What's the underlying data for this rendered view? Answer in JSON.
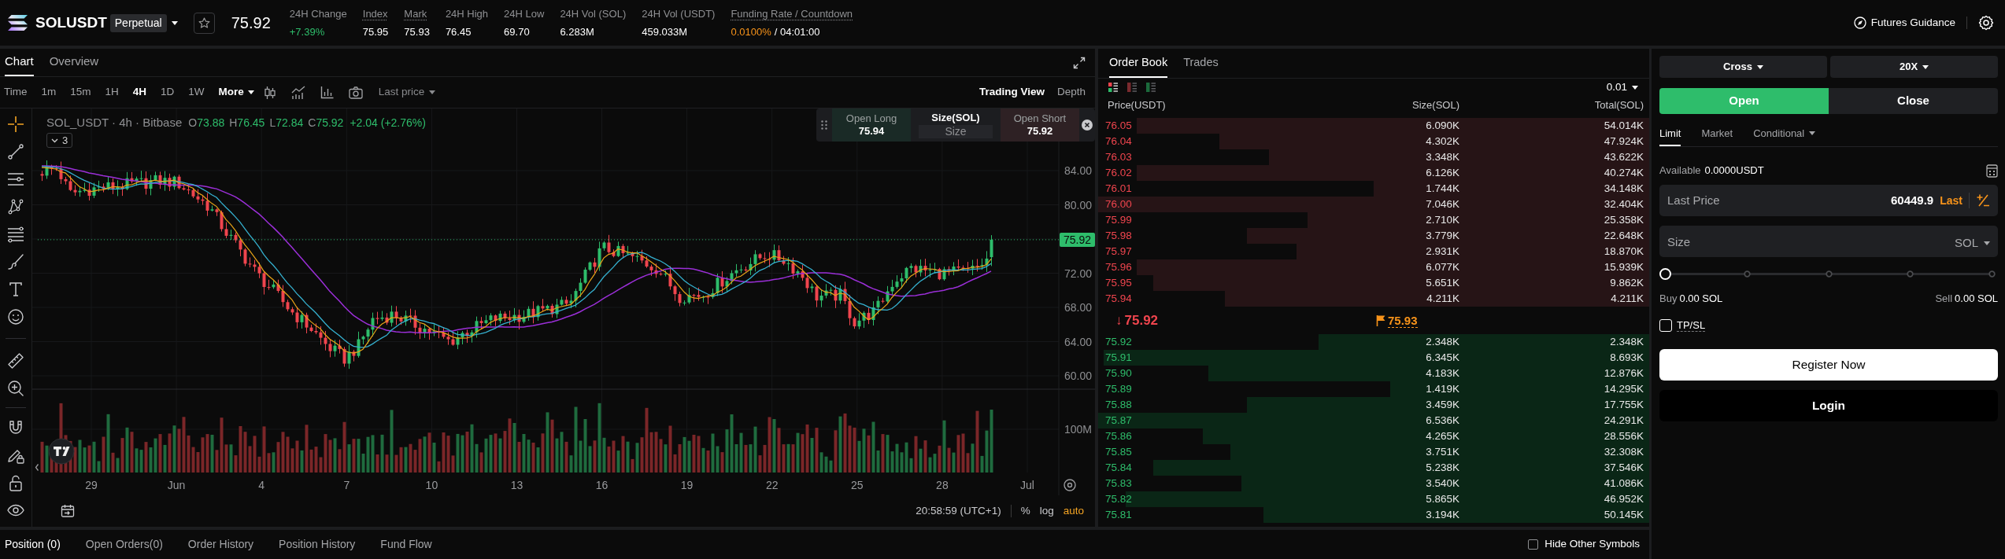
{
  "header": {
    "symbol": "SOLUSDT",
    "contract_type": "Perpetual",
    "last_price": "75.92",
    "stats": [
      {
        "label": "24H Change",
        "value": "+7.39%",
        "kind": "up",
        "tooltip": false
      },
      {
        "label": "Index",
        "value": "75.95",
        "kind": "plain",
        "tooltip": true
      },
      {
        "label": "Mark",
        "value": "75.93",
        "kind": "plain",
        "tooltip": true
      },
      {
        "label": "24H High",
        "value": "76.45",
        "kind": "plain",
        "tooltip": false
      },
      {
        "label": "24H Low",
        "value": "69.70",
        "kind": "plain",
        "tooltip": false
      },
      {
        "label": "24H Vol (SOL)",
        "value": "6.283M",
        "kind": "plain",
        "tooltip": false
      },
      {
        "label": "24H Vol (USDT)",
        "value": "459.033M",
        "kind": "plain",
        "tooltip": false
      },
      {
        "label": "Funding Rate / Countdown",
        "value": "0.0100%",
        "countdown": "/ 04:01:00",
        "kind": "funding",
        "tooltip": true
      }
    ],
    "guidance": "Futures Guidance"
  },
  "chart": {
    "tabs": [
      {
        "label": "Chart",
        "selected": true
      },
      {
        "label": "Overview",
        "selected": false
      }
    ],
    "intervals": [
      {
        "label": "Time",
        "selected": false
      },
      {
        "label": "1m",
        "selected": false
      },
      {
        "label": "15m",
        "selected": false
      },
      {
        "label": "1H",
        "selected": false
      },
      {
        "label": "4H",
        "selected": true
      },
      {
        "label": "1D",
        "selected": false
      },
      {
        "label": "1W",
        "selected": false
      }
    ],
    "more": "More",
    "price_source": "Last price",
    "views": [
      {
        "label": "Trading View",
        "selected": true
      },
      {
        "label": "Depth",
        "selected": false
      }
    ],
    "drawing_tools": [
      {
        "kind": "crosshair",
        "selected": true
      },
      {
        "kind": "trend-line",
        "selected": false
      },
      {
        "kind": "horizontal-lines",
        "selected": false
      },
      {
        "kind": "pattern",
        "selected": false
      },
      {
        "kind": "parallel-lines",
        "selected": false
      },
      {
        "kind": "brush",
        "selected": false
      },
      {
        "kind": "text",
        "selected": false
      },
      {
        "kind": "emoji",
        "selected": false
      },
      {
        "kind": "ruler",
        "selected": false
      },
      {
        "kind": "zoom",
        "selected": false
      },
      {
        "kind": "magnet",
        "selected": false
      },
      {
        "kind": "pencil-lock",
        "selected": false
      },
      {
        "kind": "lock",
        "selected": false
      },
      {
        "kind": "eye",
        "selected": false
      }
    ],
    "legend": {
      "title": "SOL_USDT · 4h · Bitbase",
      "ohlc": [
        {
          "key": "O",
          "value": "73.88"
        },
        {
          "key": "H",
          "value": "76.45"
        },
        {
          "key": "L",
          "value": "72.84"
        },
        {
          "key": "C",
          "value": "75.92"
        }
      ],
      "change": "+2.04 (+2.76%)",
      "indicators": "3"
    },
    "quick_trade": {
      "long_label": "Open Long",
      "long_price": "75.94",
      "size_label": "Size(SOL)",
      "size_placeholder": "Size",
      "short_label": "Open Short",
      "short_price": "75.92"
    },
    "price_axis": [
      "84.00",
      "80.00",
      "72.00",
      "68.00",
      "64.00",
      "60.00"
    ],
    "last_price_tag": "75.92",
    "volume_axis": "100M",
    "time_axis": [
      "29",
      "Jun",
      "4",
      "7",
      "10",
      "13",
      "16",
      "19",
      "22",
      "25",
      "28",
      "Jul"
    ],
    "clock": "20:58:59 (UTC+1)",
    "scale_options": [
      {
        "label": "%",
        "selected": false
      },
      {
        "label": "log",
        "selected": false
      },
      {
        "label": "auto",
        "selected": true
      }
    ]
  },
  "order_book": {
    "tabs": [
      {
        "label": "Order Book",
        "selected": true
      },
      {
        "label": "Trades",
        "selected": false
      }
    ],
    "layouts": [
      {
        "kind": "both",
        "selected": true
      },
      {
        "kind": "asks",
        "selected": false
      },
      {
        "kind": "bids",
        "selected": false
      }
    ],
    "precision": "0.01",
    "columns": [
      "Price(USDT)",
      "Size(SOL)",
      "Total(SOL)"
    ],
    "asks": [
      {
        "price": "76.05",
        "size": "6.090K",
        "total": "54.014K",
        "level": 0.93
      },
      {
        "price": "76.04",
        "size": "4.302K",
        "total": "47.924K",
        "level": 0.78
      },
      {
        "price": "76.03",
        "size": "3.348K",
        "total": "43.622K",
        "level": 0.69
      },
      {
        "price": "76.02",
        "size": "6.126K",
        "total": "40.274K",
        "level": 0.93
      },
      {
        "price": "76.01",
        "size": "1.744K",
        "total": "34.148K",
        "level": 0.5
      },
      {
        "price": "76.00",
        "size": "7.046K",
        "total": "32.404K",
        "level": 1
      },
      {
        "price": "75.99",
        "size": "2.710K",
        "total": "25.358K",
        "level": 0.62
      },
      {
        "price": "75.98",
        "size": "3.779K",
        "total": "22.648K",
        "level": 0.73
      },
      {
        "price": "75.97",
        "size": "2.931K",
        "total": "18.870K",
        "level": 0.64
      },
      {
        "price": "75.96",
        "size": "6.077K",
        "total": "15.939K",
        "level": 0.93
      },
      {
        "price": "75.95",
        "size": "5.651K",
        "total": "9.862K",
        "level": 0.9
      },
      {
        "price": "75.94",
        "size": "4.211K",
        "total": "4.211K",
        "level": 0.77
      }
    ],
    "last_price": {
      "arrow": "↓",
      "value": "75.92",
      "kind": "down"
    },
    "mark_price": "75.93",
    "bids": [
      {
        "price": "75.92",
        "size": "2.348K",
        "total": "2.348K",
        "level": 0.6
      },
      {
        "price": "75.91",
        "size": "6.345K",
        "total": "8.693K",
        "level": 0.99
      },
      {
        "price": "75.90",
        "size": "4.183K",
        "total": "12.876K",
        "level": 0.8
      },
      {
        "price": "75.89",
        "size": "1.419K",
        "total": "14.295K",
        "level": 0.47
      },
      {
        "price": "75.88",
        "size": "3.459K",
        "total": "17.755K",
        "level": 0.73
      },
      {
        "price": "75.87",
        "size": "6.536K",
        "total": "24.291K",
        "level": 1
      },
      {
        "price": "75.86",
        "size": "4.265K",
        "total": "28.556K",
        "level": 0.81
      },
      {
        "price": "75.85",
        "size": "3.751K",
        "total": "32.308K",
        "level": 0.76
      },
      {
        "price": "75.84",
        "size": "5.238K",
        "total": "37.546K",
        "level": 0.9
      },
      {
        "price": "75.83",
        "size": "3.540K",
        "total": "41.086K",
        "level": 0.74
      },
      {
        "price": "75.82",
        "size": "5.865K",
        "total": "46.952K",
        "level": 0.95
      },
      {
        "price": "75.81",
        "size": "3.194K",
        "total": "50.145K",
        "level": 0.7
      }
    ]
  },
  "trade_panel": {
    "margin_mode": "Cross",
    "leverage": "20X",
    "sides": [
      {
        "label": "Open",
        "selected": true
      },
      {
        "label": "Close",
        "selected": false
      }
    ],
    "order_types": [
      {
        "label": "Limit",
        "selected": true,
        "menu": false
      },
      {
        "label": "Market",
        "selected": false,
        "menu": false
      },
      {
        "label": "Conditional",
        "selected": false,
        "menu": true
      }
    ],
    "available_label": "Available",
    "available_value": "0.0000USDT",
    "price_field": {
      "label": "Last Price",
      "value": "60449.9",
      "badge": "Last"
    },
    "size_field": {
      "placeholder": "Size",
      "unit": "SOL"
    },
    "amount_slider": {
      "level": 0
    },
    "buy_label": "Buy",
    "buy_value": "0.00 SOL",
    "sell_label": "Sell",
    "sell_value": "0.00 SOL",
    "tp_sl": {
      "label": "TP/SL",
      "checked": false
    },
    "buttons": [
      {
        "label": "Register Now",
        "kind": "primary"
      },
      {
        "label": "Login",
        "kind": "secondary"
      }
    ]
  },
  "bottom_bar": {
    "tabs": [
      {
        "label": "Position (0)",
        "selected": true
      },
      {
        "label": "Open Orders(0)",
        "selected": false
      },
      {
        "label": "Order History",
        "selected": false
      },
      {
        "label": "Position History",
        "selected": false
      },
      {
        "label": "Fund Flow",
        "selected": false
      }
    ],
    "hide_other_symbols": {
      "label": "Hide Other Symbols",
      "checked": false
    }
  }
}
